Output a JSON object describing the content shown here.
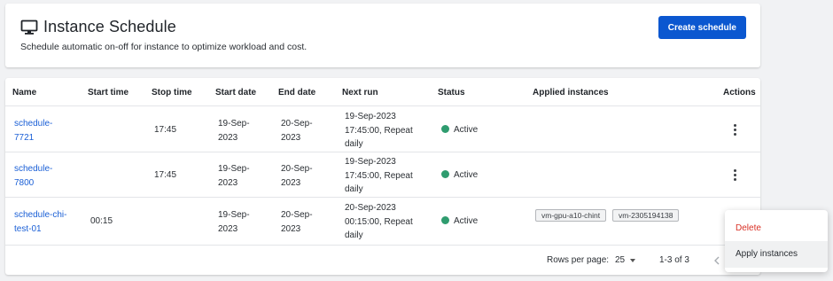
{
  "header": {
    "title": "Instance Schedule",
    "subtitle": "Schedule automatic on-off for instance to optimize workload and cost.",
    "create_button": "Create schedule"
  },
  "table": {
    "columns": [
      "Name",
      "Start time",
      "Stop time",
      "Start date",
      "End date",
      "Next run",
      "Status",
      "Applied instances",
      "Actions"
    ],
    "rows": [
      {
        "name_line1": "schedule-",
        "name_line2": "7721",
        "start_time": "",
        "stop_time": "17:45",
        "start_date_line1": "19-Sep-",
        "start_date_line2": "2023",
        "end_date_line1": "20-Sep-",
        "end_date_line2": "2023",
        "next_run_line1": "19-Sep-2023",
        "next_run_line2": "17:45:00, Repeat",
        "next_run_line3": "daily",
        "status": "Active",
        "instances": []
      },
      {
        "name_line1": "schedule-",
        "name_line2": "7800",
        "start_time": "",
        "stop_time": "17:45",
        "start_date_line1": "19-Sep-",
        "start_date_line2": "2023",
        "end_date_line1": "20-Sep-",
        "end_date_line2": "2023",
        "next_run_line1": "19-Sep-2023",
        "next_run_line2": "17:45:00, Repeat",
        "next_run_line3": "daily",
        "status": "Active",
        "instances": []
      },
      {
        "name_line1": "schedule-chi-",
        "name_line2": "test-01",
        "start_time": "00:15",
        "stop_time": "",
        "start_date_line1": "19-Sep-",
        "start_date_line2": "2023",
        "end_date_line1": "20-Sep-",
        "end_date_line2": "2023",
        "next_run_line1": "20-Sep-2023",
        "next_run_line2": "00:15:00, Repeat",
        "next_run_line3": "daily",
        "status": "Active",
        "instances": [
          "vm-gpu-a10-chint",
          "vm-2305194138"
        ]
      }
    ]
  },
  "footer": {
    "rows_per_page_label": "Rows per page:",
    "rows_per_page_value": "25",
    "range": "1-3 of 3"
  },
  "menu": {
    "delete": "Delete",
    "apply": "Apply instances"
  },
  "colors": {
    "primary": "#0b57d0",
    "link": "#1a5fd6",
    "active": "#2f9c6f",
    "danger": "#d93025"
  },
  "icons": {
    "title": "monitor-icon",
    "actions": "kebab-menu-icon",
    "status": "status-dot-icon",
    "rows_select": "chevron-down-icon",
    "pagination_prev": "chevron-left-icon"
  }
}
